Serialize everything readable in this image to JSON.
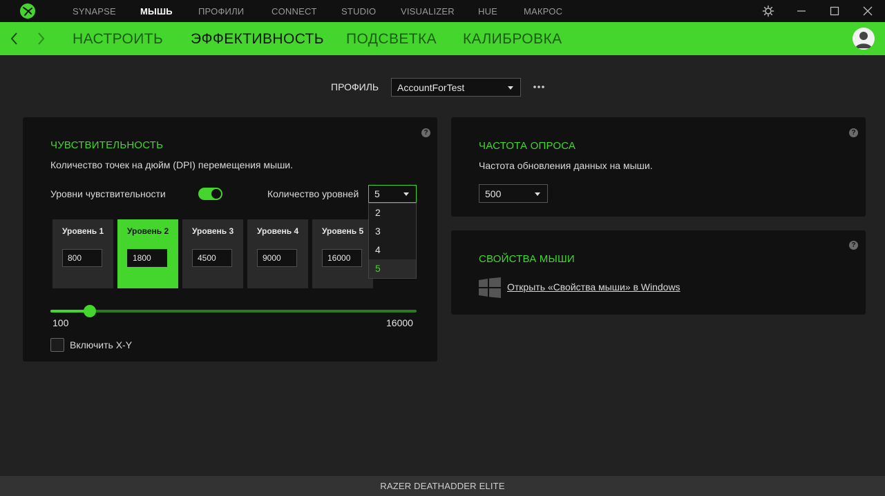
{
  "topnav": {
    "items": [
      "SYNAPSE",
      "МЫШЬ",
      "ПРОФИЛИ",
      "CONNECT",
      "STUDIO",
      "VISUALIZER",
      "HUE",
      "МАКРОС"
    ],
    "active_index": 1
  },
  "subnav": {
    "items": [
      "НАСТРОИТЬ",
      "ЭФФЕКТИВНОСТЬ",
      "ПОДСВЕТКА",
      "КАЛИБРОВКА"
    ],
    "active_index": 1
  },
  "profile": {
    "label": "ПРОФИЛЬ",
    "value": "AccountForTest"
  },
  "sensitivity": {
    "title": "ЧУВСТВИТЕЛЬНОСТЬ",
    "desc": "Количество точек на дюйм (DPI) перемещения мыши.",
    "toggle_label": "Уровни чувствительности",
    "toggle_on": true,
    "levels_label": "Количество уровней",
    "levels_value": "5",
    "levels_options": [
      "2",
      "3",
      "4",
      "5"
    ],
    "levels": [
      {
        "label": "Уровень 1",
        "value": "800"
      },
      {
        "label": "Уровень 2",
        "value": "1800"
      },
      {
        "label": "Уровень 3",
        "value": "4500"
      },
      {
        "label": "Уровень 4",
        "value": "9000"
      },
      {
        "label": "Уровень 5",
        "value": "16000"
      }
    ],
    "active_level_index": 1,
    "slider_min": "100",
    "slider_max": "16000",
    "slider_value": 1800,
    "xy_label": "Включить X-Y",
    "xy_checked": false
  },
  "polling": {
    "title": "ЧАСТОТА ОПРОСА",
    "desc": "Частота обновления данных на мыши.",
    "value": "500"
  },
  "mouse_props": {
    "title": "СВОЙСТВА МЫШИ",
    "link": "Открыть «Свойства мыши» в Windows"
  },
  "help_glyph": "?",
  "device_name": "RAZER DEATHADDER ELITE",
  "colors": {
    "accent": "#44d62c",
    "bg": "#222222",
    "panel": "#111111"
  },
  "icons": {
    "logo": "razer-logo-icon",
    "back": "chevron-left-icon",
    "forward": "chevron-right-icon",
    "settings": "gear-icon",
    "minimize": "minimize-icon",
    "maximize": "maximize-icon",
    "close": "close-icon",
    "avatar": "user-avatar-icon",
    "more": "more-dots-icon",
    "windows": "windows-logo-icon"
  }
}
